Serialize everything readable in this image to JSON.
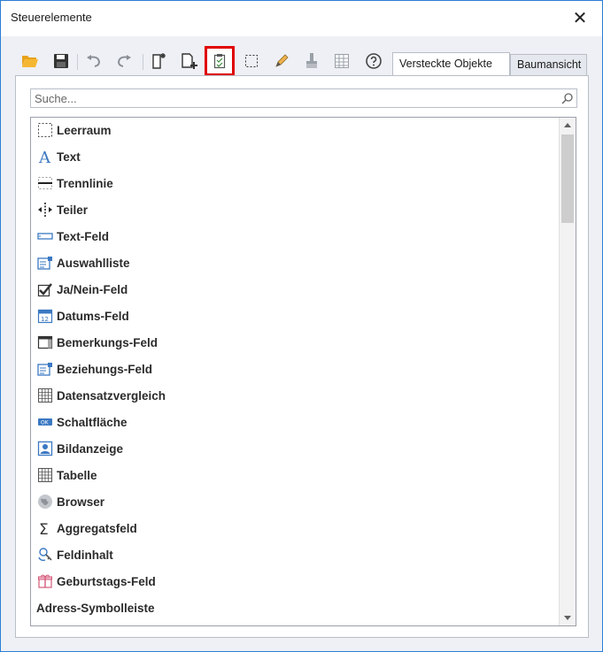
{
  "window": {
    "title": "Steuerelemente"
  },
  "toolbar": {
    "buttons": [
      {
        "name": "open-folder-icon"
      },
      {
        "name": "save-icon"
      },
      {
        "name": "undo-icon"
      },
      {
        "name": "redo-icon"
      },
      {
        "name": "new-page-icon"
      },
      {
        "name": "add-page-icon"
      },
      {
        "name": "clipboard-check-icon",
        "active": true
      },
      {
        "name": "select-rectangle-icon"
      },
      {
        "name": "pencil-icon"
      },
      {
        "name": "brush-icon"
      },
      {
        "name": "grid-icon"
      },
      {
        "name": "help-icon"
      }
    ]
  },
  "tabs": [
    {
      "label": "Versteckte Objekte",
      "selected": true
    },
    {
      "label": "Baumansicht",
      "selected": false
    }
  ],
  "search": {
    "placeholder": "Suche..."
  },
  "list": {
    "items": [
      {
        "label": "Leerraum",
        "icon": "dashed-box-icon"
      },
      {
        "label": "Text",
        "icon": "text-a-icon"
      },
      {
        "label": "Trennlinie",
        "icon": "divider-line-icon"
      },
      {
        "label": "Teiler",
        "icon": "splitter-icon"
      },
      {
        "label": "Text-Feld",
        "icon": "textbox-icon"
      },
      {
        "label": "Auswahlliste",
        "icon": "dropdown-list-icon"
      },
      {
        "label": "Ja/Nein-Feld",
        "icon": "checkbox-icon"
      },
      {
        "label": "Datums-Feld",
        "icon": "calendar-icon"
      },
      {
        "label": "Bemerkungs-Feld",
        "icon": "memo-icon"
      },
      {
        "label": "Beziehungs-Feld",
        "icon": "relation-icon"
      },
      {
        "label": "Datensatzvergleich",
        "icon": "record-grid-icon"
      },
      {
        "label": "Schaltfläche",
        "icon": "ok-button-icon"
      },
      {
        "label": "Bildanzeige",
        "icon": "picture-icon"
      },
      {
        "label": "Tabelle",
        "icon": "table-icon"
      },
      {
        "label": "Browser",
        "icon": "globe-icon"
      },
      {
        "label": "Aggregatsfeld",
        "icon": "sigma-icon"
      },
      {
        "label": "Feldinhalt",
        "icon": "field-content-icon"
      },
      {
        "label": "Geburtstags-Feld",
        "icon": "gift-icon"
      },
      {
        "label": "Adress-Symbolleiste",
        "icon": ""
      }
    ]
  },
  "colors": {
    "accent": "#2b7dd6",
    "highlight": "#e00000",
    "icon_blue": "#3a78c2"
  }
}
